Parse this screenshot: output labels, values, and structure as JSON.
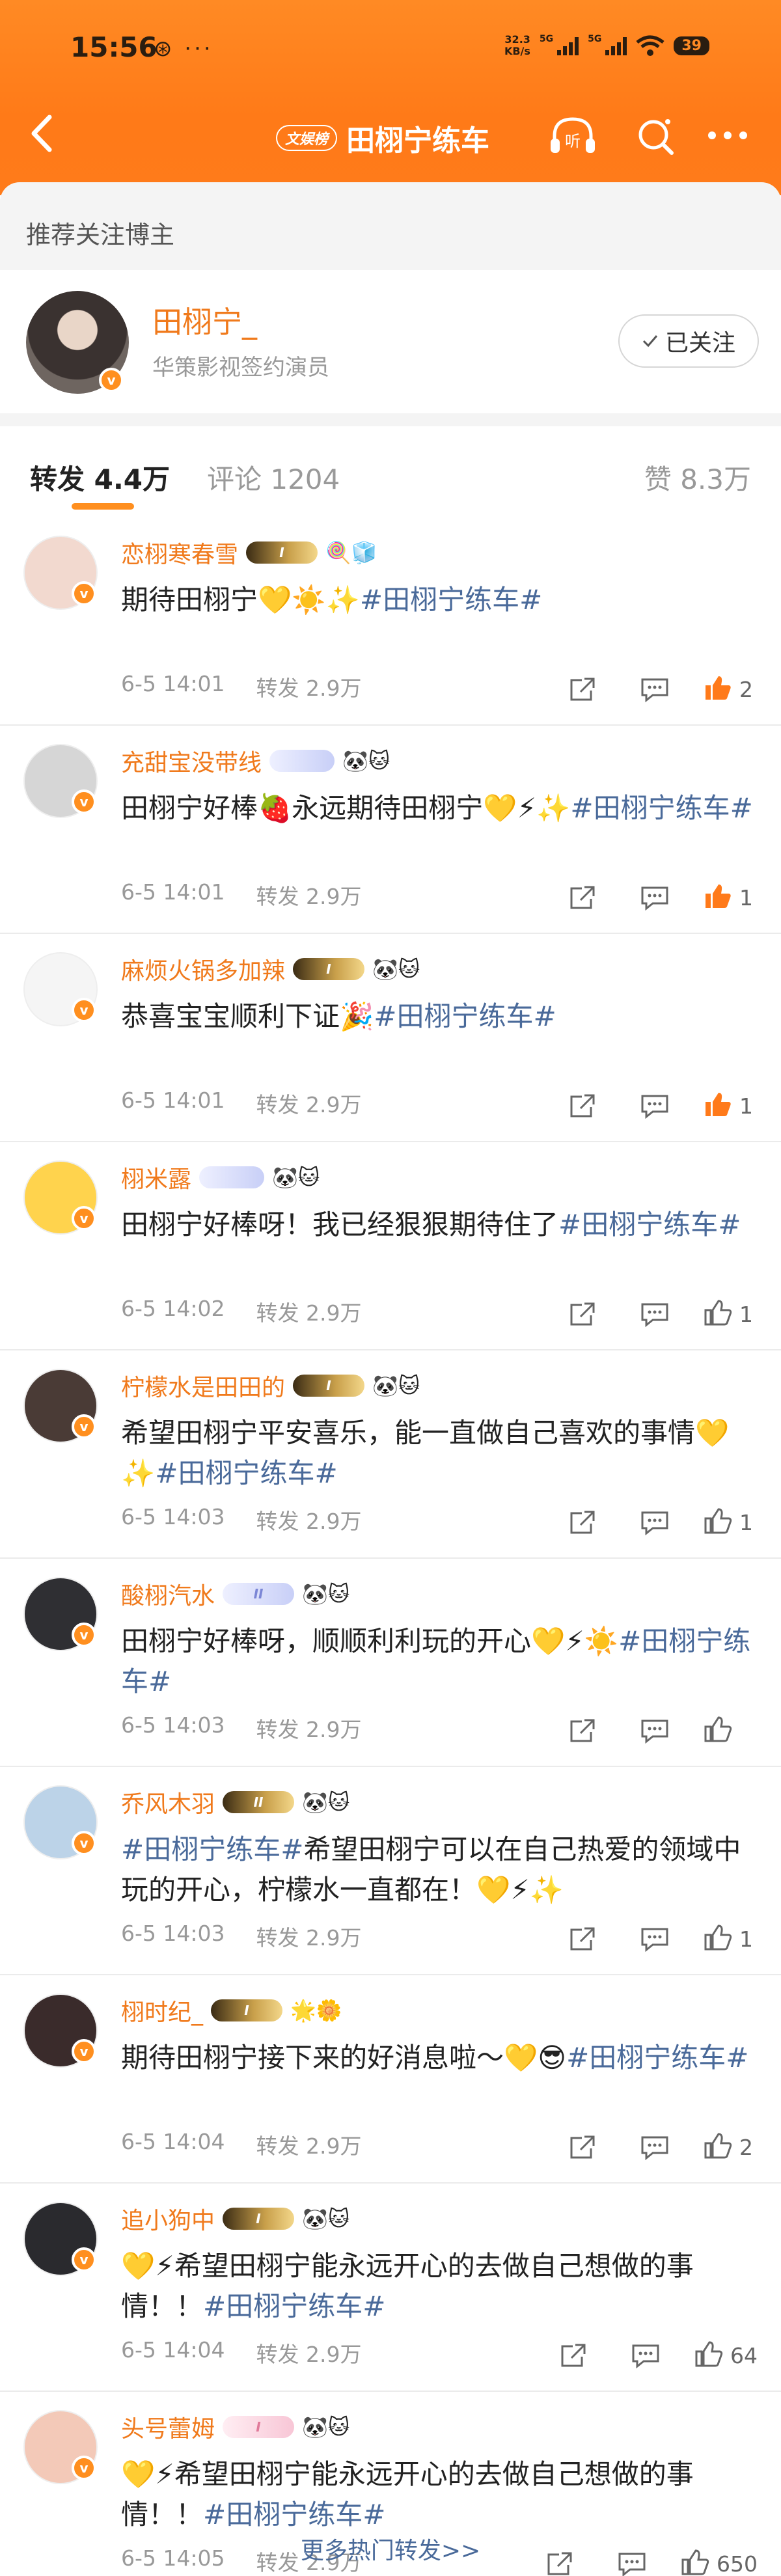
{
  "status_bar": {
    "time": "15:56",
    "extra": "⊛ ···",
    "net_speed": "32.3\nKB/s",
    "sig_label": "5G",
    "battery": "39"
  },
  "nav": {
    "badge": "文娱榜",
    "title": "田栩宁练车",
    "icons": [
      "back-arrow-icon",
      "listen-icon",
      "search-icon",
      "more-icon"
    ],
    "listen_label": "听"
  },
  "recommend": {
    "label": "推荐关注博主",
    "name": "田栩宁_",
    "desc": "华策影视签约演员",
    "follow_label": "已关注"
  },
  "tabs": {
    "repost": "转发 4.4万",
    "comment": "评论 1204",
    "like": "赞 8.3万"
  },
  "accent_color": "#ff8f1f",
  "items": [
    {
      "name": "恋栩寒春雪",
      "level": "I",
      "emojis": "🍭🧊",
      "pre": "期待田栩宁💛☀️✨",
      "tag": "#田栩宁练车#",
      "post": "",
      "time": "6-5 14:01",
      "repost": "转发 2.9万",
      "likes": "2",
      "liked": true
    },
    {
      "name": "充甜宝没带线",
      "level": "",
      "emojis": "🐼🐱",
      "pre": "田栩宁好棒🍓永远期待田栩宁💛⚡✨",
      "tag": "#田栩宁练车#",
      "post": "",
      "time": "6-5 14:01",
      "repost": "转发 2.9万",
      "likes": "1",
      "liked": true
    },
    {
      "name": "麻烦火锅多加辣",
      "level": "I",
      "emojis": "🐼🐱",
      "pre": "恭喜宝宝顺利下证🎉",
      "tag": "#田栩宁练车#",
      "post": "",
      "time": "6-5 14:01",
      "repost": "转发 2.9万",
      "likes": "1",
      "liked": true
    },
    {
      "name": "栩米露",
      "level": "",
      "emojis": "🐼🐱",
      "pre": "田栩宁好棒呀！我已经狠狠期待住了",
      "tag": "#田栩宁练车#",
      "post": "",
      "time": "6-5 14:02",
      "repost": "转发 2.9万",
      "likes": "1",
      "liked": false
    },
    {
      "name": "柠檬水是田田的",
      "level": "I",
      "emojis": "🐼🐱",
      "pre": "希望田栩宁平安喜乐，能一直做自己喜欢的事情💛✨",
      "tag": "#田栩宁练车#",
      "post": "",
      "time": "6-5 14:03",
      "repost": "转发 2.9万",
      "likes": "1",
      "liked": false
    },
    {
      "name": "酸栩汽水",
      "level": "II",
      "level_style": "light",
      "emojis": "🐼🐱",
      "pre": "田栩宁好棒呀，顺顺利利玩的开心💛⚡☀️",
      "tag": "#田栩宁练车#",
      "post": "",
      "time": "6-5 14:03",
      "repost": "转发 2.9万",
      "likes": "",
      "liked": false
    },
    {
      "name": "乔风木羽",
      "level": "II",
      "emojis": "🐼🐱",
      "pre": "",
      "tag": "#田栩宁练车#",
      "post": "希望田栩宁可以在自己热爱的领域中玩的开心，柠檬水一直都在！💛⚡✨",
      "time": "6-5 14:03",
      "repost": "转发 2.9万",
      "likes": "1",
      "liked": false
    },
    {
      "name": "栩时纪_",
      "level": "I",
      "emojis": "🌟🌼",
      "pre": "期待田栩宁接下来的好消息啦～💛😎",
      "tag": "#田栩宁练车#",
      "post": "",
      "time": "6-5 14:04",
      "repost": "转发 2.9万",
      "likes": "2",
      "liked": false
    },
    {
      "name": "追小狗中",
      "level": "I",
      "emojis": "🐼🐱",
      "pre": "💛⚡希望田栩宁能永远开心的去做自己想做的事情！！",
      "tag": "#田栩宁练车#",
      "post": "",
      "time": "6-5 14:04",
      "repost": "转发 2.9万",
      "likes": "64",
      "liked": false
    },
    {
      "name": "头号蕾姆",
      "level": "I",
      "level_style": "pink",
      "emojis": "🐼🐱",
      "pre": "💛⚡希望田栩宁能永远开心的去做自己想做的事情！！",
      "tag": "#田栩宁练车#",
      "post": "",
      "time": "6-5 14:05",
      "repost": "转发 2.9万",
      "likes": "650",
      "liked": false
    }
  ],
  "more_link": "更多热门转发>>"
}
